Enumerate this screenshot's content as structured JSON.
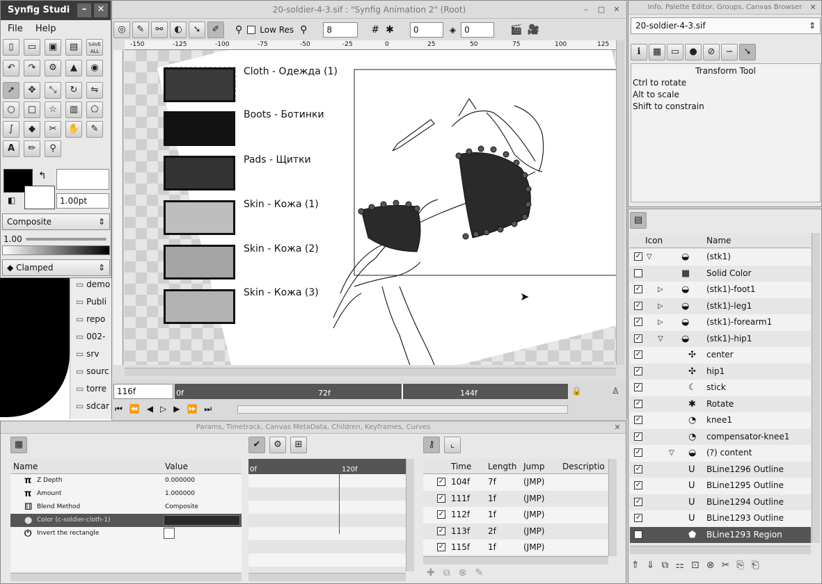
{
  "toolbox": {
    "title": "Synfig Studi",
    "menu": [
      "File",
      "Help"
    ],
    "brush_size": "1.00pt",
    "blend": "Composite",
    "amount": "1.00",
    "interp": "Clamped",
    "save_all": "SAVE ALL"
  },
  "files": [
    "demo",
    "Publi",
    "repo",
    "002-",
    "srv",
    "sourc",
    "torre",
    "sdcar"
  ],
  "canvas": {
    "title": "20-soldier-4-3.sif : \"Synfig Animation 2\" (Root)",
    "low_res": "Low Res",
    "spin1": "8",
    "spin2": "0",
    "spin3": "0",
    "ruler": [
      "-150",
      "-125",
      "-100",
      "-75",
      "-50",
      "-25",
      "0",
      "25",
      "50",
      "75",
      "100",
      "125"
    ],
    "swatches": [
      {
        "label": "Cloth - Одежда (1)",
        "color": "#3a3a3a"
      },
      {
        "label": "Boots - Ботинки",
        "color": "#121212"
      },
      {
        "label": "Pads - Щитки",
        "color": "#333333"
      },
      {
        "label": "Skin - Кожа (1)",
        "color": "#bebebe"
      },
      {
        "label": "Skin - Кожа (2)",
        "color": "#a5a5a5"
      },
      {
        "label": "Skin - Кожа (3)",
        "color": "#b2b2b2"
      }
    ],
    "current_frame": "116f",
    "timebar_ticks": [
      "0f",
      "72f",
      "144f"
    ]
  },
  "info_panel": {
    "title": "Info, Palette Editor, Groups, Canvas Browser",
    "file_select": "20-soldier-4-3.sif",
    "tool_name": "Transform Tool",
    "hints": [
      "Ctrl to rotate",
      "Alt to scale",
      "Shift to constrain"
    ]
  },
  "layers": {
    "headers": {
      "icon": "Icon",
      "name": "Name"
    },
    "rows": [
      {
        "name": "(stk1)",
        "checked": true,
        "expander": "▽",
        "indent": 0,
        "icon": "layer-group-icon",
        "selected": false
      },
      {
        "name": "Solid Color",
        "checked": false,
        "expander": "",
        "indent": 0,
        "icon": "solid-color-icon",
        "selected": false
      },
      {
        "name": "(stk1)-foot1",
        "checked": true,
        "expander": "▷",
        "indent": 1,
        "icon": "layer-group-icon",
        "selected": false
      },
      {
        "name": "(stk1)-leg1",
        "checked": true,
        "expander": "▷",
        "indent": 1,
        "icon": "layer-group-icon",
        "selected": false
      },
      {
        "name": "(stk1)-forearm1",
        "checked": true,
        "expander": "▷",
        "indent": 1,
        "icon": "layer-group-icon",
        "selected": false
      },
      {
        "name": "(stk1)-hip1",
        "checked": true,
        "expander": "▽",
        "indent": 1,
        "icon": "layer-group-icon",
        "selected": false
      },
      {
        "name": "center",
        "checked": true,
        "expander": "",
        "indent": 2,
        "icon": "translate-icon",
        "selected": false
      },
      {
        "name": "hip1",
        "checked": true,
        "expander": "",
        "indent": 2,
        "icon": "translate-icon",
        "selected": false
      },
      {
        "name": "stick",
        "checked": true,
        "expander": "",
        "indent": 2,
        "icon": "skeleton-icon",
        "selected": false
      },
      {
        "name": "Rotate",
        "checked": true,
        "expander": "",
        "indent": 2,
        "icon": "rotate-icon",
        "selected": false
      },
      {
        "name": "knee1",
        "checked": true,
        "expander": "",
        "indent": 2,
        "icon": "stretch-icon",
        "selected": false
      },
      {
        "name": "compensator-knee1",
        "checked": true,
        "expander": "",
        "indent": 2,
        "icon": "stretch-icon",
        "selected": false
      },
      {
        "name": "(?) content",
        "checked": true,
        "expander": "▽",
        "indent": 2,
        "icon": "layer-group-icon",
        "selected": false
      },
      {
        "name": "BLine1296 Outline",
        "checked": true,
        "expander": "",
        "indent": 3,
        "icon": "outline-icon",
        "selected": false
      },
      {
        "name": "BLine1295 Outline",
        "checked": true,
        "expander": "",
        "indent": 3,
        "icon": "outline-icon",
        "selected": false
      },
      {
        "name": "BLine1294 Outline",
        "checked": true,
        "expander": "",
        "indent": 3,
        "icon": "outline-icon",
        "selected": false
      },
      {
        "name": "BLine1293 Outline",
        "checked": true,
        "expander": "",
        "indent": 3,
        "icon": "outline-icon",
        "selected": false
      },
      {
        "name": "BLine1293 Region",
        "checked": true,
        "expander": "",
        "indent": 3,
        "icon": "region-icon",
        "selected": true
      }
    ]
  },
  "bottom_panel": {
    "title": "Params, Timetrack, Canvas MetaData, Children, Keyframes, Curves",
    "params_headers": {
      "name": "Name",
      "value": "Value"
    },
    "params": [
      {
        "name": "Z Depth",
        "value": "0.000000",
        "icon": "pi-icon"
      },
      {
        "name": "Amount",
        "value": "1.000000",
        "icon": "pi-icon"
      },
      {
        "name": "Blend Method",
        "value": "Composite",
        "icon": "blend-icon"
      },
      {
        "name": "Color (c-soldier-cloth-1)",
        "value": "",
        "icon": "color-icon"
      },
      {
        "name": "Invert the rectangle",
        "value": "",
        "icon": "power-icon"
      }
    ],
    "timetrack_ticks": [
      "0f",
      "120f"
    ],
    "keyframe_headers": {
      "time": "Time",
      "length": "Length",
      "jump": "Jump",
      "desc": "Descriptio"
    },
    "keyframes": [
      {
        "time": "104f",
        "length": "7f",
        "jump": "(JMP)"
      },
      {
        "time": "111f",
        "length": "1f",
        "jump": "(JMP)"
      },
      {
        "time": "112f",
        "length": "1f",
        "jump": "(JMP)"
      },
      {
        "time": "113f",
        "length": "2f",
        "jump": "(JMP)"
      },
      {
        "time": "115f",
        "length": "1f",
        "jump": "(JMP)"
      }
    ]
  }
}
